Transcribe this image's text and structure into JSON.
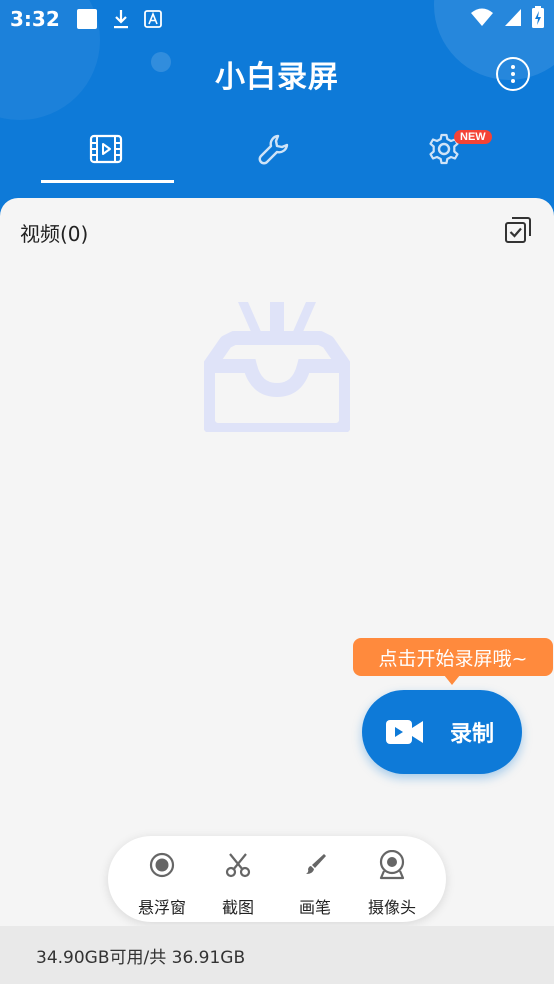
{
  "statusbar": {
    "time": "3:32"
  },
  "app": {
    "title": "小白录屏"
  },
  "tabs": [
    {
      "name": "video",
      "icon": "video-icon"
    },
    {
      "name": "tools",
      "icon": "wrench-icon"
    },
    {
      "name": "settings",
      "icon": "gear-icon",
      "badge": "NEW"
    }
  ],
  "videos": {
    "title": "视频(0)"
  },
  "tooltip": {
    "text": "点击开始录屏哦~"
  },
  "record": {
    "label": "录制"
  },
  "toolbar": {
    "items": [
      {
        "label": "悬浮窗",
        "icon": "floating-window-icon"
      },
      {
        "label": "截图",
        "icon": "scissors-icon"
      },
      {
        "label": "画笔",
        "icon": "brush-icon"
      },
      {
        "label": "摄像头",
        "icon": "camera-icon"
      }
    ]
  },
  "storage": {
    "text": "34.90GB可用/共 36.91GB"
  },
  "colors": {
    "primary": "#0e7ad8",
    "tooltip": "#ff8a3d",
    "badge": "#f44336",
    "empty_icon": "#dfe3f8"
  }
}
